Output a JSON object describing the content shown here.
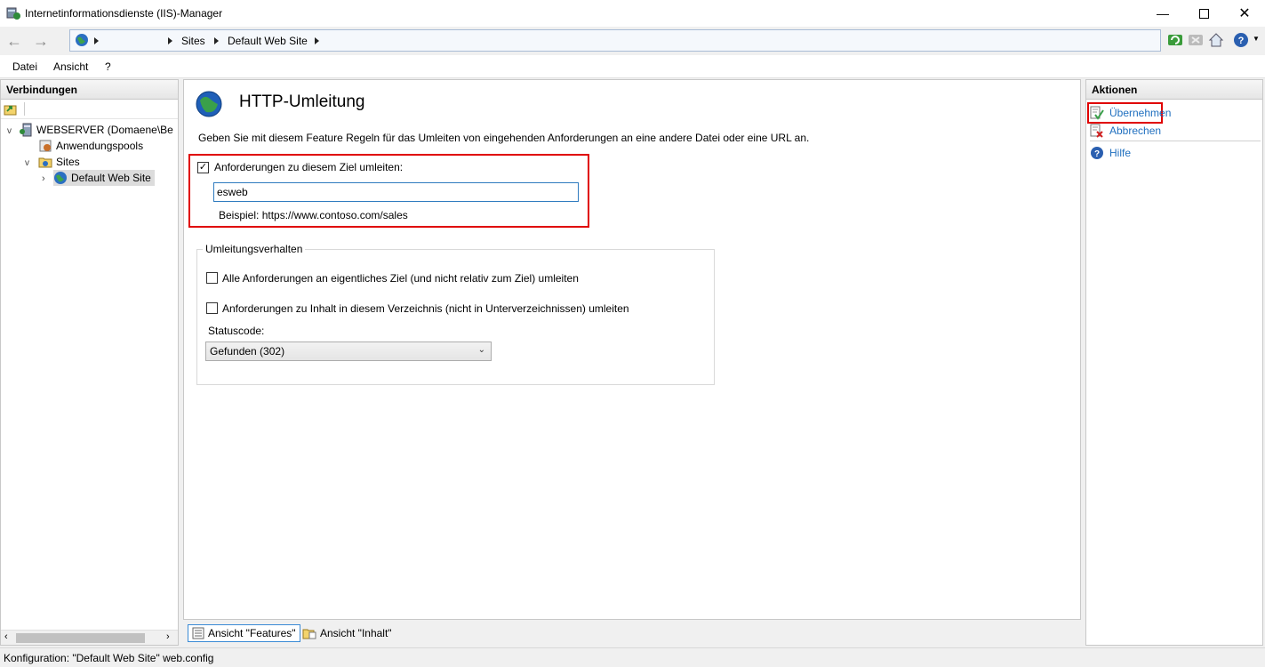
{
  "window": {
    "title": "Internetinformationsdienste (IIS)-Manager",
    "controls": [
      "minimize",
      "maximize",
      "close"
    ]
  },
  "address": {
    "segments": [
      "Sites",
      "Default Web Site"
    ]
  },
  "menu": {
    "items": [
      "Datei",
      "Ansicht",
      "?"
    ]
  },
  "connections": {
    "header": "Verbindungen",
    "tree": {
      "server": "WEBSERVER (Domaene\\Be",
      "app_pools": "Anwendungspools",
      "sites": "Sites",
      "default_site": "Default Web Site"
    }
  },
  "feature": {
    "title": "HTTP-Umleitung",
    "description": "Geben Sie mit diesem Feature Regeln für das Umleiten von eingehenden Anforderungen an eine andere Datei oder eine URL an.",
    "redirect_checkbox": {
      "label": "Anforderungen zu diesem Ziel umleiten:",
      "checked": true
    },
    "target_value": "esweb",
    "example": "Beispiel: https://www.contoso.com/sales",
    "behavior": {
      "legend": "Umleitungsverhalten",
      "exact_destination": {
        "label": "Alle Anforderungen an eigentliches Ziel (und nicht relativ zum Ziel) umleiten",
        "checked": false
      },
      "only_this_dir": {
        "label": "Anforderungen zu Inhalt in diesem Verzeichnis (nicht in Unterverzeichnissen) umleiten",
        "checked": false
      },
      "status_label": "Statuscode:",
      "status_value": "Gefunden (302)"
    }
  },
  "view_tabs": {
    "features": "Ansicht \"Features\"",
    "content": "Ansicht \"Inhalt\""
  },
  "actions": {
    "header": "Aktionen",
    "apply": "Übernehmen",
    "cancel": "Abbrechen",
    "help": "Hilfe"
  },
  "status": {
    "text": "Konfiguration: \"Default Web Site\" web.config"
  },
  "colors": {
    "highlight": "#e00000",
    "link": "#1f6fbf",
    "focus": "#2f7bbf"
  }
}
